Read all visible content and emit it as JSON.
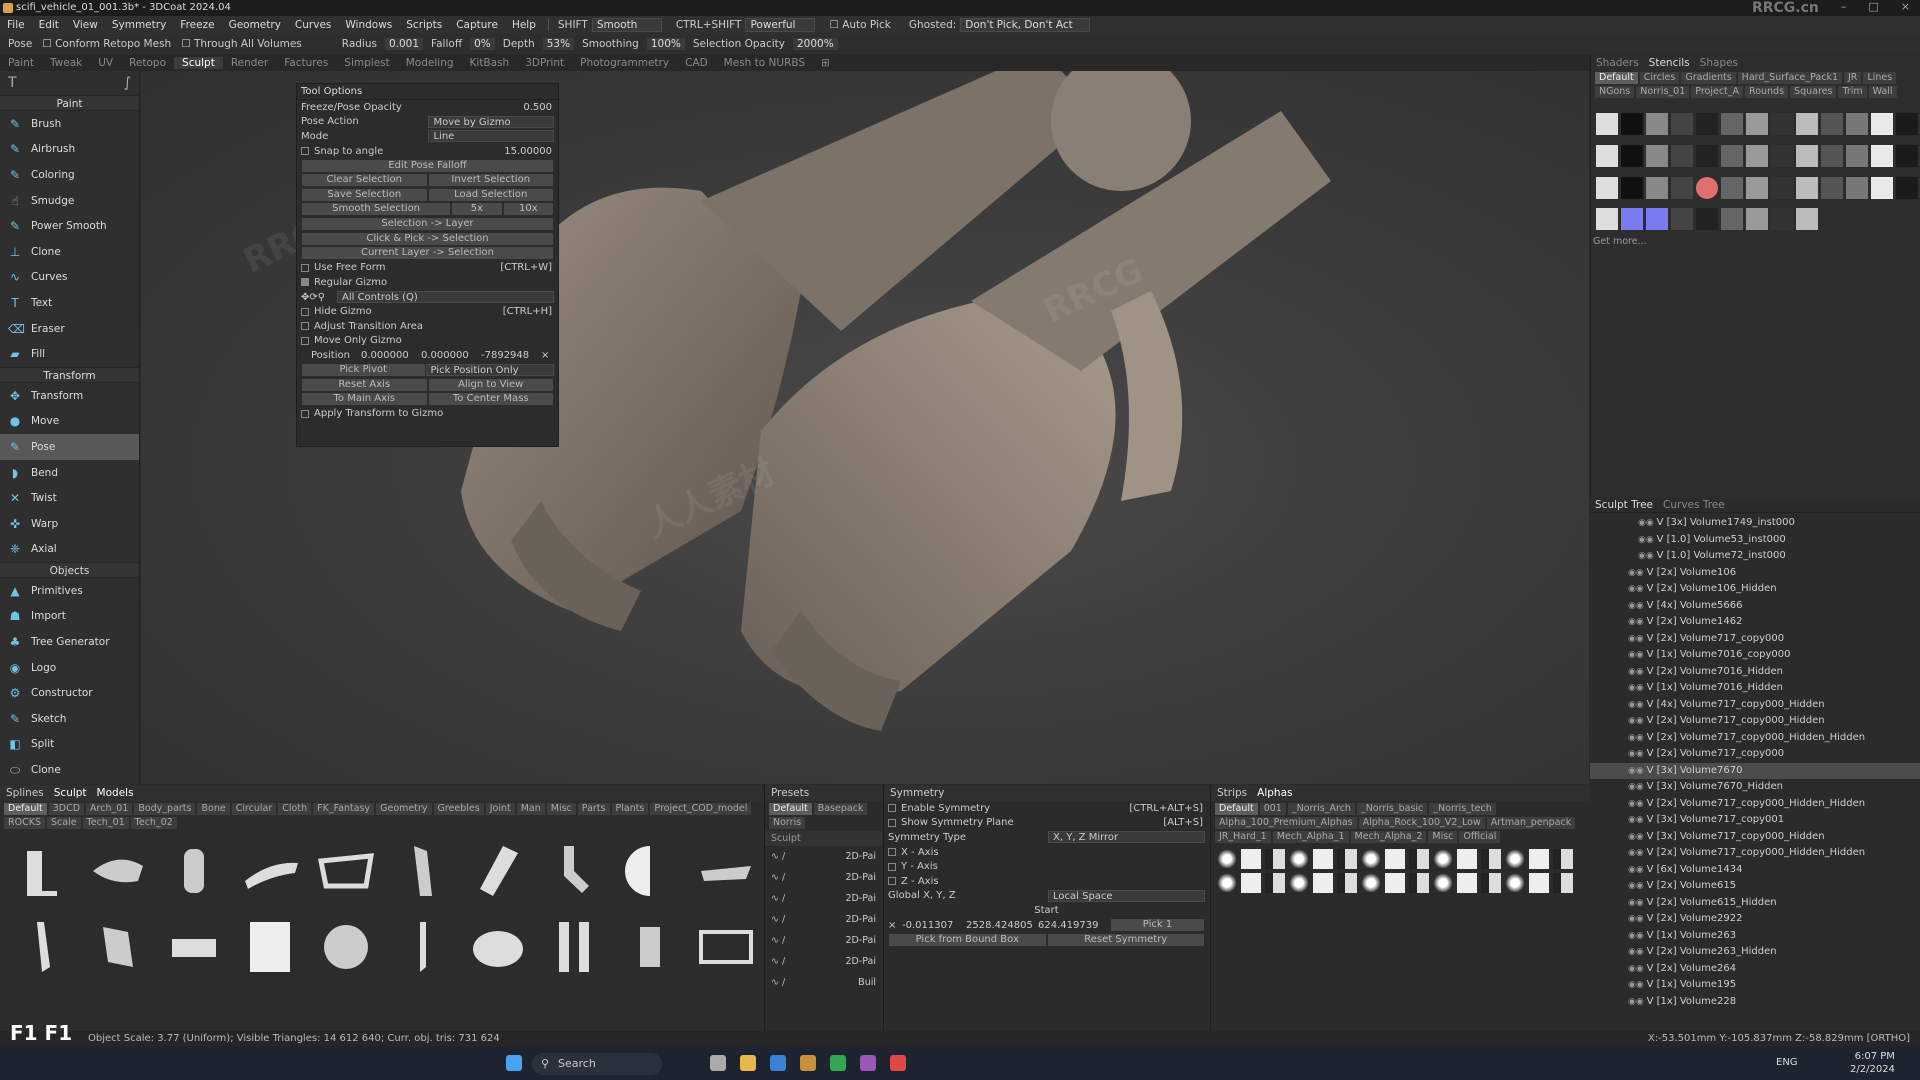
{
  "window": {
    "title": "scifi_vehicle_01_001.3b* - 3DCoat 2024.04",
    "watermark_top": "RRCG.cn"
  },
  "menu": {
    "items": [
      "File",
      "Edit",
      "View",
      "Symmetry",
      "Freeze",
      "Geometry",
      "Curves",
      "Windows",
      "Scripts",
      "Capture",
      "Help"
    ],
    "shift_label": "SHIFT",
    "shift_value": "Smooth",
    "ctrlshift_label": "CTRL+SHIFT",
    "ctrlshift_value": "Powerful",
    "autopick": "Auto Pick",
    "ghosted_label": "Ghosted:",
    "ghosted_value": "Don't Pick, Don't Act"
  },
  "toolbar": {
    "pose": "Pose",
    "conform": "Conform Retopo Mesh",
    "through": "Through All Volumes",
    "radius_label": "Radius",
    "radius": "0.001",
    "falloff_label": "Falloff",
    "falloff": "0%",
    "depth_label": "Depth",
    "depth": "53%",
    "smoothing_label": "Smoothing",
    "smoothing": "100%",
    "selopacity_label": "Selection Opacity",
    "selopacity": "2000%"
  },
  "rooms": [
    "Paint",
    "Tweak",
    "UV",
    "Retopo",
    "Sculpt",
    "Render",
    "Factures",
    "Simplest",
    "Modeling",
    "KitBash",
    "3DPrint",
    "Photogrammetry",
    "CAD",
    "Mesh to NURBS"
  ],
  "left": {
    "paint_head": "Paint",
    "paint": [
      "Brush",
      "Airbrush",
      "Coloring",
      "Smudge",
      "Power Smooth",
      "Clone",
      "Curves",
      "Text",
      "Eraser",
      "Fill"
    ],
    "transform_head": "Transform",
    "transform": [
      "Transform",
      "Move",
      "Pose",
      "Bend",
      "Twist",
      "Warp",
      "Axial"
    ],
    "objects_head": "Objects",
    "objects": [
      "Primitives",
      "Import",
      "Tree Generator",
      "Logo",
      "Constructor",
      "Sketch",
      "Split",
      "Clone"
    ]
  },
  "tooloptions": {
    "title": "Tool Options",
    "freeze_label": "Freeze/Pose Opacity",
    "freeze_value": "0.500",
    "pose_action_label": "Pose Action",
    "pose_action": "Move by Gizmo",
    "mode_label": "Mode",
    "mode": "Line",
    "snap_label": "Snap to angle",
    "snap_value": "15.00000",
    "edit_falloff": "Edit Pose Falloff",
    "clear_sel": "Clear Selection",
    "invert_sel": "Invert Selection",
    "save_sel": "Save Selection",
    "load_sel": "Load Selection",
    "smooth_sel": "Smooth Selection",
    "x5": "5x",
    "x10": "10x",
    "sel_layer": "Selection -> Layer",
    "click_pick": "Click & Pick -> Selection",
    "cur_layer": "Current Layer -> Selection",
    "free_form": "Use Free Form",
    "free_form_key": "[CTRL+W]",
    "regular_gizmo": "Regular Gizmo",
    "all_controls": "All Controls (Q)",
    "hide_gizmo": "Hide Gizmo",
    "hide_gizmo_key": "[CTRL+H]",
    "adjust_area": "Adjust Transition Area",
    "move_only": "Move Only Gizmo",
    "position_label": "Position",
    "pos_x": "0.000000",
    "pos_y": "0.000000",
    "pos_z": "-7892948",
    "pick_pivot": "Pick Pivot",
    "pick_position": "Pick Position Only",
    "reset_axis": "Reset Axis",
    "align_view": "Align to View",
    "main_axis": "To Main Axis",
    "center_mass": "To Center Mass",
    "apply_transform": "Apply Transform to Gizmo"
  },
  "right": {
    "tabs": [
      "Shaders",
      "Stencils",
      "Shapes"
    ],
    "chips1": [
      "Default",
      "Circles",
      "Gradients",
      "Hard_Surface_Pack1",
      "JR",
      "Lines",
      "NGons"
    ],
    "chips2": [
      "Norris_01",
      "Project_A",
      "Rounds",
      "Squares",
      "Trim",
      "Wall"
    ],
    "get_more": "Get more...",
    "tree_tabs": [
      "Sculpt",
      "Tree",
      "Curves",
      "Tree"
    ],
    "tree": [
      {
        "l": "V [3x] Volume1749_inst000",
        "i": 1
      },
      {
        "l": "V [1.0] Volume53_inst000",
        "i": 1
      },
      {
        "l": "V [1.0] Volume72_inst000",
        "i": 1
      },
      {
        "l": "V [2x] Volume106",
        "i": 0
      },
      {
        "l": "V [2x] Volume106_Hidden",
        "i": 0
      },
      {
        "l": "V [4x] Volume5666",
        "i": 0
      },
      {
        "l": "V [2x] Volume1462",
        "i": 0
      },
      {
        "l": "V [2x] Volume717_copy000",
        "i": 0
      },
      {
        "l": "V [1x] Volume7016_copy000",
        "i": 0
      },
      {
        "l": "V [2x] Volume7016_Hidden",
        "i": 0
      },
      {
        "l": "V [1x] Volume7016_Hidden",
        "i": 0
      },
      {
        "l": "V [4x] Volume717_copy000_Hidden",
        "i": 0
      },
      {
        "l": "V [2x] Volume717_copy000_Hidden",
        "i": 0
      },
      {
        "l": "V [2x] Volume717_copy000_Hidden_Hidden",
        "i": 0
      },
      {
        "l": "V [2x] Volume717_copy000",
        "i": 0
      },
      {
        "l": "V [3x] Volume7670",
        "i": 0,
        "sel": 1
      },
      {
        "l": "V [3x] Volume7670_Hidden",
        "i": 0
      },
      {
        "l": "V [2x] Volume717_copy000_Hidden_Hidden",
        "i": 0
      },
      {
        "l": "V [3x] Volume717_copy001",
        "i": 0
      },
      {
        "l": "V [3x] Volume717_copy000_Hidden",
        "i": 0
      },
      {
        "l": "V [2x] Volume717_copy000_Hidden_Hidden",
        "i": 0
      },
      {
        "l": "V [6x] Volume1434",
        "i": 0
      },
      {
        "l": "V [2x] Volume615",
        "i": 0
      },
      {
        "l": "V [2x] Volume615_Hidden",
        "i": 0
      },
      {
        "l": "V [2x] Volume2922",
        "i": 0
      },
      {
        "l": "V [1x] Volume263",
        "i": 0
      },
      {
        "l": "V [2x] Volume263_Hidden",
        "i": 0
      },
      {
        "l": "V [2x] Volume264",
        "i": 0
      },
      {
        "l": "V [1x] Volume195",
        "i": 0
      },
      {
        "l": "V [1x] Volume228",
        "i": 0
      }
    ]
  },
  "models": {
    "tabs": [
      "Splines",
      "Sculpt",
      "Models"
    ],
    "chips": [
      "Default",
      "3DCD",
      "Arch_01",
      "Body_parts",
      "Bone",
      "Circular",
      "Cloth",
      "FK_Fantasy",
      "Geometry",
      "Greebles",
      "Joint",
      "Man",
      "Misc",
      "Parts",
      "Plants",
      "Project_COD_model",
      "ROCKS",
      "Scale",
      "Tech_01",
      "Tech_02"
    ]
  },
  "presets": {
    "title": "Presets",
    "tabs": [
      "Default",
      "Basepack"
    ],
    "search": "Norris",
    "group": "Sculpt",
    "items": [
      "2D-Pai",
      "2D-Pai",
      "2D-Pai",
      "2D-Pai",
      "2D-Pai",
      "2D-Pai",
      "Buil"
    ]
  },
  "symmetry": {
    "title": "Symmetry",
    "enable": "Enable Symmetry",
    "enable_key": "[CTRL+ALT+S]",
    "show_plane": "Show Symmetry Plane",
    "show_key": "[ALT+S]",
    "type_label": "Symmetry Type",
    "type": "X, Y, Z Mirror",
    "x": "X - Axis",
    "y": "Y - Axis",
    "z": "Z - Axis",
    "global": "Global X, Y, Z",
    "space": "Local Space",
    "start": "Start",
    "sx": "-0.011307",
    "sy": "2528.424805",
    "sz": "624.419739",
    "pick": "Pick 1",
    "pick_bound": "Pick from Bound Box",
    "reset": "Reset Symmetry"
  },
  "alphas": {
    "tabs": [
      "Strips",
      "Alphas"
    ],
    "chips1": [
      "Default",
      "001",
      "_Norris_Arch",
      "_Norris_basic",
      "_Norris_tech"
    ],
    "chips2": [
      "Alpha_100_Premium_Alphas",
      "Alpha_Rock_100_V2_Low",
      "Artman_penpack"
    ],
    "chips3": [
      "JR_Hard_1",
      "Mech_Alpha_1",
      "Mech_Alpha_2",
      "Misc",
      "Official"
    ]
  },
  "status": {
    "left": "Object Scale: 3.77 (Uniform); Visible Triangles: 14 612 640; Curr. obj. tris: 731 624",
    "right": "X:-53.501mm  Y:-105.837mm  Z:-58.829mm  [ORTHO]",
    "fkey": "F1 F1"
  },
  "taskbar": {
    "search": "Search",
    "lang": "ENG",
    "time": "6:07 PM",
    "date": "2/2/2024"
  },
  "watermarks": [
    "RRCG",
    "人人素材",
    "RRCG"
  ]
}
